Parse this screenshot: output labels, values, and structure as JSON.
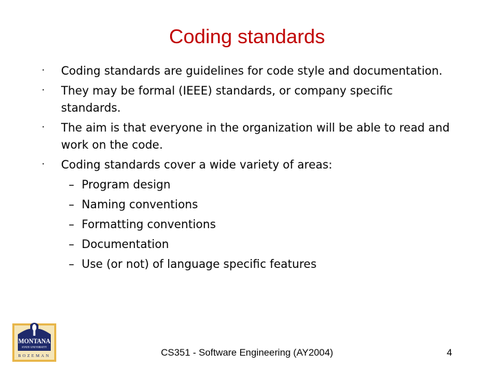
{
  "slide": {
    "title": "Coding standards",
    "bullets": [
      {
        "text": "Coding standards are guidelines for code style and documentation."
      },
      {
        "text": "They may be formal (IEEE) standards, or company specific standards."
      },
      {
        "text": "The aim is that everyone in the organization will be able to read and work on the code."
      },
      {
        "text": "Coding standards cover a wide variety of areas:",
        "subitems": [
          "Program design",
          "Naming conventions",
          "Formatting conventions",
          "Documentation",
          "Use (or not) of language specific features"
        ]
      }
    ],
    "bullet_glyph": "·",
    "sub_glyph": "–"
  },
  "footer": {
    "text": "CS351 - Software Engineering (AY2004)",
    "page_number": "4"
  },
  "logo": {
    "icon": "montana-state-university-logo",
    "line1": "MONTANA",
    "line2": "STATE UNIVERSITY",
    "line3": "BOZEMAN",
    "colors": {
      "navy": "#1f2a6b",
      "gold": "#e8b64a",
      "cream": "#f5e6b8"
    }
  },
  "colors": {
    "title": "#c00000",
    "text": "#000000",
    "background": "#ffffff"
  }
}
